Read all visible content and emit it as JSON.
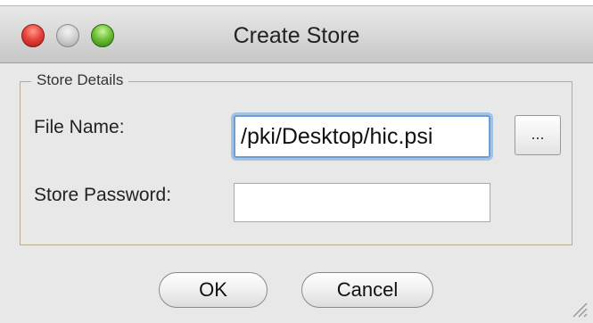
{
  "window": {
    "title": "Create Store",
    "controls": {
      "close": "close-icon",
      "minimize": "minimize-icon",
      "zoom": "zoom-icon"
    }
  },
  "store_details": {
    "legend": "Store Details",
    "file_name_label": "File Name:",
    "file_name_value": "/pki/Desktop/hic.psi",
    "browse_label": "...",
    "password_label": "Store Password:",
    "password_value": ""
  },
  "buttons": {
    "ok": "OK",
    "cancel": "Cancel"
  },
  "colors": {
    "close_light": "#e8453c",
    "zoom_light": "#6fc23a",
    "focus_ring": "#6b9fd6",
    "group_border": "#b7ae8e"
  }
}
